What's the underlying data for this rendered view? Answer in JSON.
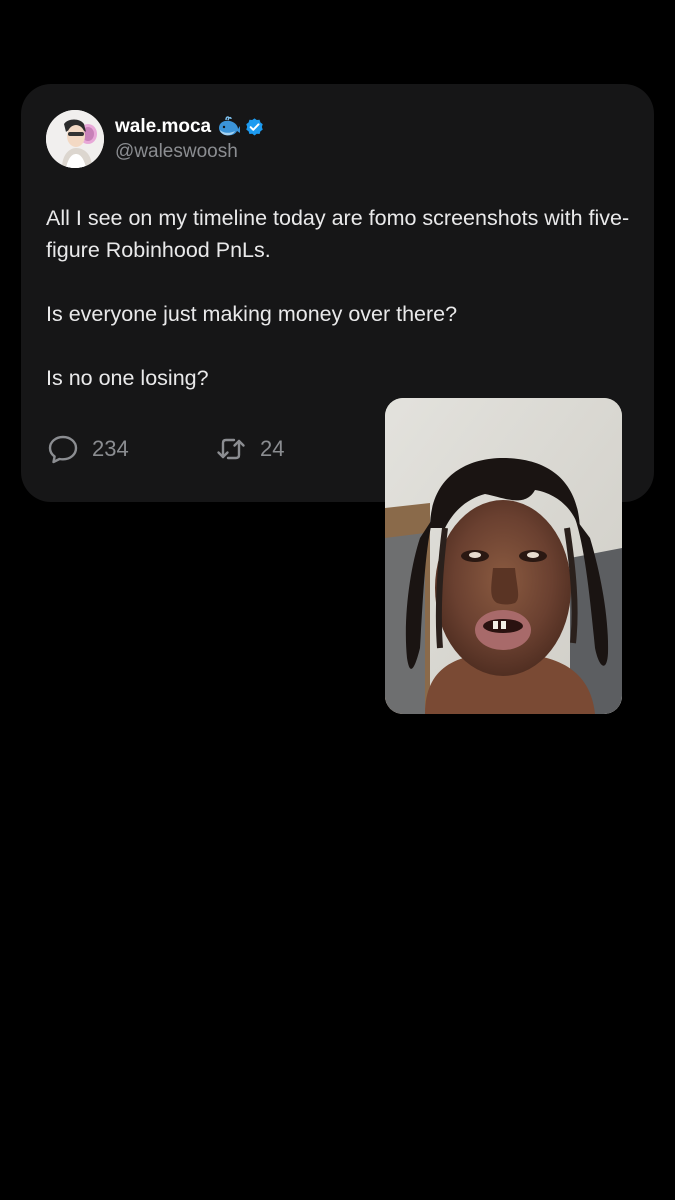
{
  "tweet": {
    "author": {
      "display_name": "wale.moca",
      "handle": "@waleswoosh",
      "name_emoji_icon": "whale-emoji-icon",
      "verified_icon": "verified-badge-icon",
      "verified_color": "#1d9bf0"
    },
    "paragraphs": [
      "All I see on my timeline today are fomo screenshots with five-figure Robinhood PnLs.",
      "Is everyone just making money over there?",
      "Is no one losing?"
    ],
    "metrics": {
      "replies": "234",
      "reposts": "24",
      "reply_icon": "comment-bubble-icon",
      "repost_icon": "repost-arrows-icon"
    }
  },
  "overlay": {
    "type": "video-call-picture-in-picture",
    "content": "face-camera-feed"
  },
  "colors": {
    "page_background": "#000000",
    "card_background": "#161617",
    "primary_text": "#e9e9ea",
    "secondary_text": "#8b8d91"
  }
}
